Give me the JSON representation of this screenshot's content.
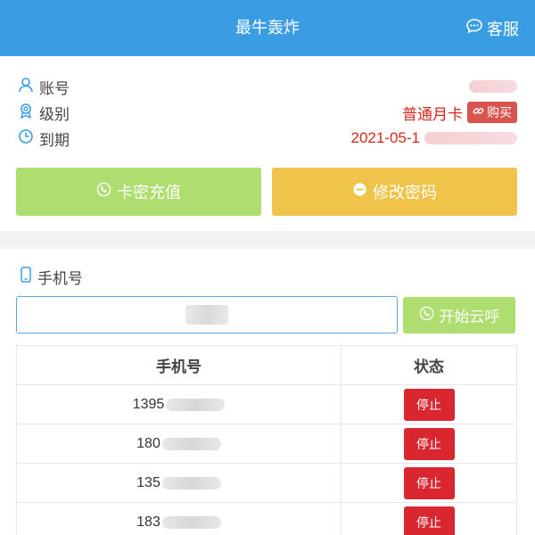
{
  "header": {
    "title": "最牛轰炸",
    "service_label": "客服",
    "background_color": "#3a9de3"
  },
  "account": {
    "username_label": "账号",
    "level_label": "级别",
    "level_value": "普通月卡",
    "buy_label": "购买",
    "expire_label": "到期",
    "expire_value": "2021-05-1"
  },
  "actions": {
    "recharge_label": "卡密充值",
    "password_label": "修改密码"
  },
  "phone": {
    "label": "手机号",
    "input_value": "",
    "call_label": "开始云呼"
  },
  "table": {
    "headers": {
      "phone": "手机号",
      "status": "状态"
    },
    "rows": [
      {
        "phone": "1395",
        "action": "停止"
      },
      {
        "phone": "180",
        "action": "停止"
      },
      {
        "phone": "135",
        "action": "停止"
      },
      {
        "phone": "183",
        "action": "停止"
      }
    ]
  },
  "icons": {
    "service": "chat-icon",
    "username": "user-icon",
    "level": "award-icon",
    "expire": "clock-icon",
    "buy": "link-icon",
    "recharge": "phone-circle-icon",
    "password": "minus-circle-icon",
    "phone_label": "mobile-icon",
    "call": "phone-circle-icon"
  },
  "colors": {
    "accent": "#3a9de3",
    "danger": "#d9261c",
    "success_button": "#aedd70",
    "warning_button": "#f0c44a",
    "stop_button": "#d9262f"
  }
}
